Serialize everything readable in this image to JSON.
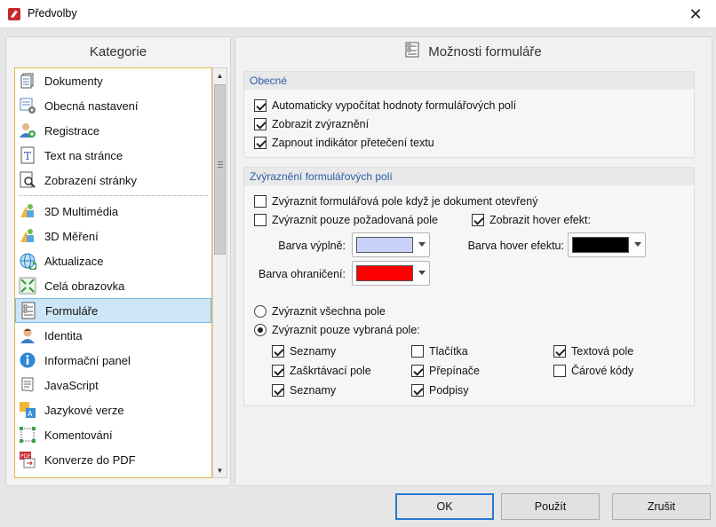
{
  "window": {
    "title": "Předvolby",
    "close_glyph": "✕"
  },
  "left": {
    "header": "Kategorie",
    "items_top": [
      {
        "label": "Dokumenty",
        "icon": "documents-icon"
      },
      {
        "label": "Obecná nastavení",
        "icon": "general-settings-icon"
      },
      {
        "label": "Registrace",
        "icon": "registration-icon"
      },
      {
        "label": "Text na stránce",
        "icon": "text-on-page-icon"
      },
      {
        "label": "Zobrazení stránky",
        "icon": "page-display-icon"
      }
    ],
    "items_bottom": [
      {
        "label": "3D Multimédia",
        "icon": "3d-multimedia-icon"
      },
      {
        "label": "3D Měření",
        "icon": "3d-measure-icon"
      },
      {
        "label": "Aktualizace",
        "icon": "update-globe-icon"
      },
      {
        "label": "Celá obrazovka",
        "icon": "fullscreen-icon"
      },
      {
        "label": "Formuláře",
        "icon": "forms-icon",
        "selected": true
      },
      {
        "label": "Identita",
        "icon": "identity-icon"
      },
      {
        "label": "Informační panel",
        "icon": "info-panel-icon"
      },
      {
        "label": "JavaScript",
        "icon": "javascript-icon"
      },
      {
        "label": "Jazykové verze",
        "icon": "language-icon"
      },
      {
        "label": "Komentování",
        "icon": "commenting-icon"
      },
      {
        "label": "Konverze do PDF",
        "icon": "pdf-conversion-icon"
      }
    ]
  },
  "right": {
    "header": "Možnosti formuláře",
    "general": {
      "title": "Obecné",
      "options": [
        {
          "label": "Automaticky vypočítat hodnoty formulářových polí",
          "checked": true
        },
        {
          "label": "Zobrazit zvýraznění",
          "checked": true
        },
        {
          "label": "Zapnout indikátor přetečení textu",
          "checked": true
        }
      ]
    },
    "highlight": {
      "title": "Zvýraznění formulářových polí",
      "on_open": {
        "label": "Zvýraznit formulářová pole když je dokument otevřený",
        "checked": false
      },
      "required_only": {
        "label": "Zvýraznit pouze požadovaná pole",
        "checked": false
      },
      "hover": {
        "label": "Zobrazit hover efekt:",
        "checked": true
      },
      "fill_color_label": "Barva výplně:",
      "fill_color": "#c8d2fb",
      "hover_color_label": "Barva hover efektu:",
      "hover_color": "#000000",
      "border_color_label": "Barva ohraničení:",
      "border_color": "#ff0000",
      "radio_all": {
        "label": "Zvýraznit všechna pole",
        "checked": false
      },
      "radio_selected": {
        "label": "Zvýraznit pouze vybraná pole:",
        "checked": true
      },
      "types": [
        {
          "label": "Seznamy",
          "checked": true
        },
        {
          "label": "Tlačítka",
          "checked": false
        },
        {
          "label": "Textová pole",
          "checked": true
        },
        {
          "label": "Zaškrtávací pole",
          "checked": true
        },
        {
          "label": "Přepínače",
          "checked": true
        },
        {
          "label": "Čárové kódy",
          "checked": false
        },
        {
          "label": "Seznamy",
          "checked": true
        },
        {
          "label": "Podpisy",
          "checked": true
        }
      ]
    }
  },
  "buttons": {
    "ok": "OK",
    "apply": "Použít",
    "cancel": "Zrušit"
  }
}
